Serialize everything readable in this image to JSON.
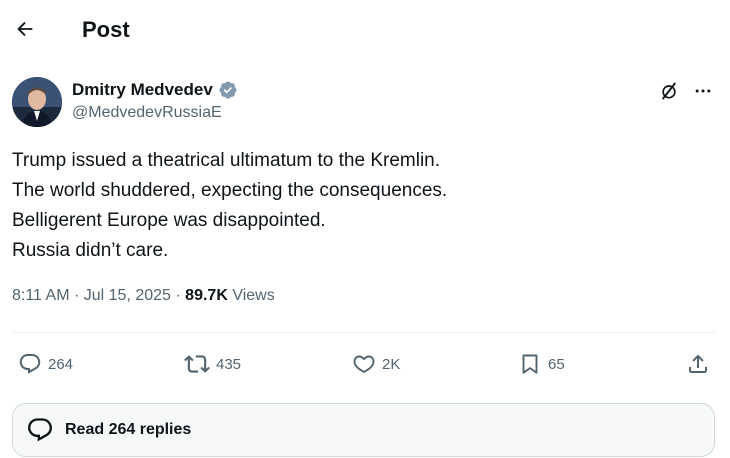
{
  "header": {
    "title": "Post",
    "back_icon": "arrow-left-icon"
  },
  "author": {
    "name": "Dmitry Medvedev",
    "handle": "@MedvedevRussiaE",
    "verified_badge_color": "#829aab"
  },
  "post": {
    "lines": [
      "Trump issued a theatrical ultimatum to the Kremlin.",
      "The world shuddered, expecting the consequences.",
      "Belligerent Europe was disappointed.",
      "Russia didn’t care."
    ],
    "time": "8:11 AM",
    "date": "Jul 15, 2025",
    "views_count": "89.7K",
    "views_label": "Views"
  },
  "actions": {
    "replies": "264",
    "reposts": "435",
    "likes": "2K",
    "bookmarks": "65"
  },
  "replies_box": {
    "label": "Read 264 replies"
  },
  "colors": {
    "text": "#0f1419",
    "secondary": "#536471",
    "border": "#cfd9de"
  }
}
